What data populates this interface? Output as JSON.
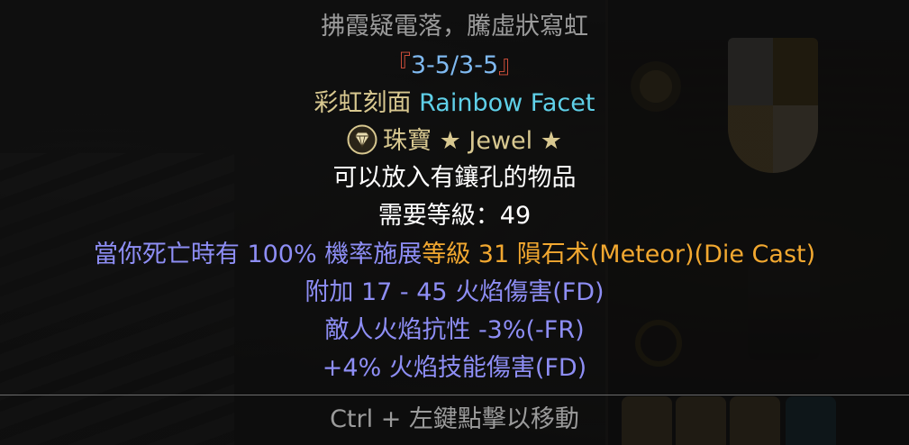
{
  "tooltip": {
    "affix_name": "拂霞疑電落，騰虛狀寫虹",
    "level_range": "『3-5/3-5』",
    "item_name_zh": "彩虹刻面",
    "item_name_en": "Rainbow Facet",
    "type_zh": "珠寶",
    "type_en": "★ Jewel ★",
    "type_icon": "diamond-icon",
    "socket_text": "可以放入有鑲孔的物品",
    "required_level": "需要等級：49",
    "proc_prefix": "當你死亡時有 100% 機率施展",
    "proc_skill": "等級 31 隕石术(Meteor)(Die Cast)",
    "stat_fire_damage": "附加 17 - 45 火焰傷害(FD)",
    "stat_fire_resist": "敵人火焰抗性 -3%(-FR)",
    "stat_fire_skill": "+4% 火焰技能傷害(FD)",
    "footer_hint": "Ctrl + 左鍵點擊以移動"
  },
  "colors": {
    "affix_gray": "#9b9b9b",
    "level_range_red": "#e0543f",
    "level_range_blue": "#7fb9f0",
    "item_name_gold": "#d8c890",
    "item_name_cyan": "#5fd0e8",
    "magic_blue": "#8e8ef5",
    "skill_orange": "#f2a830"
  }
}
